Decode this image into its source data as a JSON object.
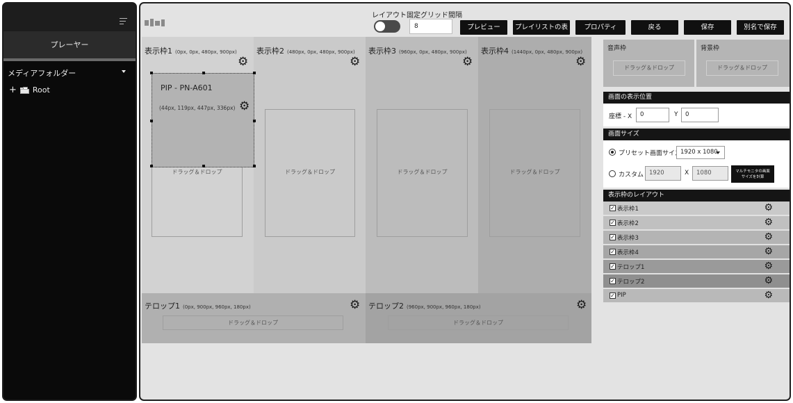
{
  "sidebar": {
    "player_label": "プレーヤー",
    "media_folder_label": "メディアフォルダー",
    "root_item": {
      "expander": "+",
      "label": "Root"
    }
  },
  "toolbar": {
    "grid_label": "レイアウト固定グリッド間隔",
    "grid_value": "8",
    "buttons": {
      "preview": "プレビュー",
      "playlist": "プレイリストの表示",
      "properties": "プロパティ",
      "back": "戻る",
      "save": "保存",
      "save_as": "別名で保存"
    }
  },
  "frames": [
    {
      "title": "表示枠1",
      "coords": "(0px, 0px, 480px, 900px)",
      "drop": "ドラッグ＆ドロップ"
    },
    {
      "title": "表示枠2",
      "coords": "(480px, 0px, 480px, 900px)",
      "drop": "ドラッグ＆ドロップ"
    },
    {
      "title": "表示枠3",
      "coords": "(960px, 0px, 480px, 900px)",
      "drop": "ドラッグ＆ドロップ"
    },
    {
      "title": "表示枠4",
      "coords": "(1440px, 0px, 480px, 900px)",
      "drop": "ドラッグ＆ドロップ"
    }
  ],
  "telops": [
    {
      "title": "テロップ1",
      "coords": "(0px, 900px, 960px, 180px)",
      "drop": "ドラッグ＆ドロップ"
    },
    {
      "title": "テロップ2",
      "coords": "(960px, 900px, 960px, 180px)",
      "drop": "ドラッグ＆ドロップ"
    }
  ],
  "pip": {
    "title": "PIP - PN-A601",
    "coords": "(44px, 119px, 447px, 336px)"
  },
  "audio_frame": {
    "title": "音声枠",
    "drop": "ドラッグ＆ドロップ"
  },
  "background_frame": {
    "title": "背景枠",
    "drop": "ドラッグ＆ドロップ"
  },
  "screen_position": {
    "header": "画面の表示位置",
    "coord_label": "座標 - X",
    "x_value": "0",
    "y_label": "Y",
    "y_value": "0"
  },
  "screen_size": {
    "header": "画面サイズ",
    "preset_label": "プリセット画面サイズ",
    "preset_value": "1920 x 1080",
    "custom_label": "カスタム",
    "custom_width": "1920",
    "x_label": "X",
    "custom_height": "1080",
    "calc_button_line1": "マルチモニタの画面",
    "calc_button_line2": "サイズを計算"
  },
  "layout_list": {
    "header": "表示枠のレイアウト",
    "check_mark": "✓",
    "items": [
      {
        "label": "表示枠1",
        "checked": true,
        "bg": "#c9c9c9"
      },
      {
        "label": "表示枠2",
        "checked": true,
        "bg": "#c0c0c0"
      },
      {
        "label": "表示枠3",
        "checked": true,
        "bg": "#b4b4b4"
      },
      {
        "label": "表示枠4",
        "checked": true,
        "bg": "#a6a6a6"
      },
      {
        "label": "テロップ1",
        "checked": true,
        "bg": "#9a9a9a"
      },
      {
        "label": "テロップ2",
        "checked": true,
        "bg": "#8f8f8f"
      },
      {
        "label": "PIP",
        "checked": true,
        "bg": "#b9b9b9"
      }
    ]
  },
  "icons": {
    "gear": "⚙",
    "menu": "hamburger-menu-icon",
    "folder": "folder-icon"
  },
  "colors": {
    "frame1": "#d2d2d2",
    "frame2": "#cacaca",
    "frame3": "#bcbcbc",
    "frame4": "#adadad",
    "telop1": "#b0b0b0",
    "telop2": "#a3a3a3"
  }
}
